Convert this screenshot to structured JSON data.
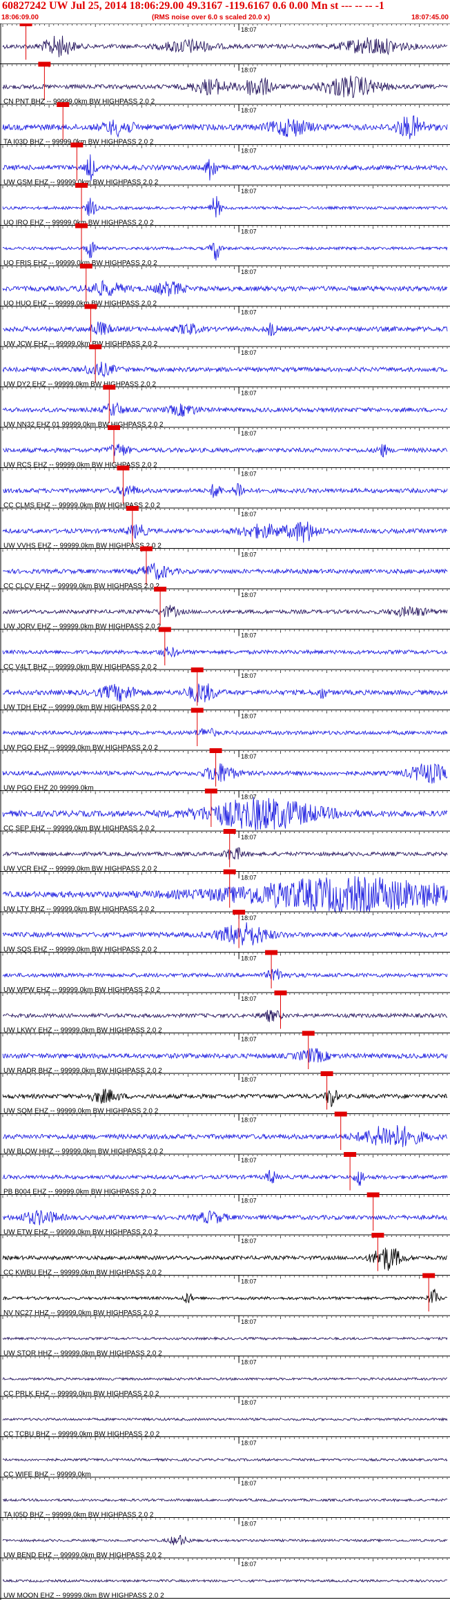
{
  "header": {
    "title": "60827242 UW Jul 25, 2014 18:06:29.00   49.3167 -119.6167  0.6 0.00 Mn st --- -- -- -1",
    "start_time": "18:06:09.00",
    "note": "(RMS noise over 6.0 s scaled 20.0 x)",
    "end_time": "18:07:45.00"
  },
  "chart_data": {
    "type": "line",
    "title": "60827242 UW Jul 25, 2014 18:06:29.00   49.3167 -119.6167  0.6 0.00 Mn st --- -- -- -1",
    "x_start": "18:06:09.00",
    "x_end": "18:07:45.00",
    "x_range_seconds": [
      0,
      96
    ],
    "minute_tick_label": "18:07",
    "minute_tick_second": 51,
    "colors": {
      "blue": "#1f1fe0",
      "navy": "#281860",
      "black": "#000000",
      "pick": "#e00000"
    },
    "traces": [
      {
        "label": "",
        "color": "navy",
        "amp": 0.9,
        "pick": 5,
        "bursts": [
          [
            12,
            3,
            1.0
          ],
          [
            40,
            5,
            0.6
          ],
          [
            80,
            6,
            0.8
          ]
        ]
      },
      {
        "label": "CN PNT BHZ -- 99999.0km BW  HIGHPASS  2.0  2",
        "color": "navy",
        "amp": 0.9,
        "pick": 9,
        "bursts": [
          [
            45,
            4,
            0.7
          ],
          [
            55,
            3,
            1.0
          ],
          [
            75,
            6,
            1.0
          ]
        ]
      },
      {
        "label": "TA I03D BHZ -- 99999.0km BW  HIGHPASS  2.0  2",
        "color": "blue",
        "amp": 1.2,
        "pick": 13,
        "bursts": [
          [
            25,
            3,
            0.7
          ],
          [
            62,
            4,
            0.8
          ],
          [
            88,
            3,
            1.0
          ]
        ]
      },
      {
        "label": "UW GSM EHZ -- 99999.0km BW  HIGHPASS  2.0  2",
        "color": "blue",
        "amp": 1.0,
        "pick": 16,
        "bursts": [
          [
            19,
            1,
            1.2
          ],
          [
            45,
            1,
            1.4
          ]
        ]
      },
      {
        "label": "UO IRO EHZ -- 99999.0km BW  HIGHPASS  2.0  2",
        "color": "blue",
        "amp": 0.6,
        "pick": 17,
        "bursts": [
          [
            19,
            1,
            1.0
          ],
          [
            46,
            1,
            1.2
          ]
        ]
      },
      {
        "label": "UO FRIS EHZ -- 99999.0km BW  HIGHPASS  2.0  2",
        "color": "blue",
        "amp": 0.6,
        "pick": 17,
        "bursts": [
          [
            19,
            1,
            1.0
          ],
          [
            46,
            1,
            1.2
          ]
        ]
      },
      {
        "label": "UO HUO EHZ -- 99999.0km BW  HIGHPASS  2.0  2",
        "color": "blue",
        "amp": 1.0,
        "pick": 18,
        "bursts": [
          [
            22,
            4,
            0.6
          ],
          [
            36,
            3,
            0.6
          ]
        ]
      },
      {
        "label": "UW JCW EHZ -- 99999.0km BW  HIGHPASS  2.0  2",
        "color": "blue",
        "amp": 1.0,
        "pick": 19,
        "bursts": [
          [
            21,
            2,
            0.6
          ],
          [
            40,
            2,
            0.5
          ],
          [
            58,
            1,
            0.6
          ]
        ]
      },
      {
        "label": "UW DY2 EHZ -- 99999.0km BW  HIGHPASS  2.0  2",
        "color": "blue",
        "amp": 0.9,
        "pick": 20,
        "bursts": [
          [
            21,
            3,
            0.6
          ]
        ]
      },
      {
        "label": "UW NN32 EHZ 01 99999.0km BW  HIGHPASS  2.0  2",
        "color": "blue",
        "amp": 0.9,
        "pick": 23,
        "bursts": [
          [
            24,
            2,
            0.6
          ],
          [
            39,
            3,
            0.5
          ]
        ]
      },
      {
        "label": "UW RCS EHZ -- 99999.0km BW  HIGHPASS  2.0  2",
        "color": "blue",
        "amp": 0.9,
        "pick": 24,
        "bursts": [
          [
            25,
            2,
            0.6
          ],
          [
            82,
            1,
            0.6
          ]
        ]
      },
      {
        "label": "CC CLMS EHZ -- 99999.0km BW  HIGHPASS  2.0  2",
        "color": "blue",
        "amp": 0.9,
        "pick": 26,
        "bursts": [
          [
            27,
            2,
            0.5
          ],
          [
            46,
            1,
            0.8
          ],
          [
            51,
            1,
            0.9
          ]
        ]
      },
      {
        "label": "UW VVHS EHZ -- 99999.0km BW  HIGHPASS  2.0  2",
        "color": "blue",
        "amp": 0.9,
        "pick": 28,
        "bursts": [
          [
            29,
            2,
            0.6
          ],
          [
            56,
            5,
            0.6
          ],
          [
            65,
            3,
            1.0
          ]
        ]
      },
      {
        "label": "CC CLCV EHZ -- 99999.0km BW  HIGHPASS  2.0  2",
        "color": "blue",
        "amp": 0.9,
        "pick": 31,
        "bursts": [
          [
            33,
            3,
            0.7
          ]
        ]
      },
      {
        "label": "UW JORV EHZ -- 99999.0km BW  HIGHPASS  2.0  2",
        "color": "navy",
        "amp": 0.8,
        "pick": 34,
        "bursts": [
          [
            36,
            2,
            0.5
          ],
          [
            88,
            4,
            0.4
          ]
        ]
      },
      {
        "label": "CC V4LT BHZ -- 99999.0km BW  HIGHPASS  2.0  2",
        "color": "blue",
        "amp": 0.8,
        "pick": 35,
        "bursts": [
          [
            36,
            2,
            0.4
          ]
        ]
      },
      {
        "label": "UW TDH EHZ -- 99999.0km BW  HIGHPASS  2.0  2",
        "color": "blue",
        "amp": 1.0,
        "pick": 42,
        "bursts": [
          [
            25,
            4,
            0.7
          ],
          [
            43,
            3,
            0.9
          ],
          [
            69,
            1,
            0.5
          ]
        ]
      },
      {
        "label": "UW PGO EHZ -- 99999.0km BW  HIGHPASS  2.0  2",
        "color": "blue",
        "amp": 0.8,
        "pick": 42,
        "bursts": [
          [
            44,
            2,
            0.4
          ]
        ]
      },
      {
        "label": "UW PGO EHZ 20 99999.0km",
        "color": "blue",
        "amp": 0.9,
        "pick": 46,
        "bursts": [
          [
            47,
            3,
            0.9
          ],
          [
            92,
            4,
            0.9
          ]
        ]
      },
      {
        "label": "CC SEP EHZ -- 99999.0km BW  HIGHPASS  2.0  2",
        "color": "blue",
        "amp": 1.2,
        "pick": 45,
        "bursts": [
          [
            56,
            12,
            1.5
          ]
        ]
      },
      {
        "label": "UW VCR EHZ -- 99999.0km BW  HIGHPASS  2.0  2",
        "color": "navy",
        "amp": 0.8,
        "pick": 49,
        "bursts": [
          [
            50,
            2,
            0.6
          ]
        ]
      },
      {
        "label": "UW LTY BHZ -- 99999.0km BW  HIGHPASS  2.0  2",
        "color": "blue",
        "amp": 1.2,
        "pick": 49,
        "bursts": [
          [
            75,
            25,
            1.6
          ]
        ]
      },
      {
        "label": "UW SQS EHZ -- 99999.0km BW  HIGHPASS  2.0  2",
        "color": "blue",
        "amp": 1.0,
        "pick": 51,
        "bursts": [
          [
            52,
            5,
            1.1
          ]
        ]
      },
      {
        "label": "UW WPW EHZ -- 99999.0km BW  HIGHPASS  2.0  2",
        "color": "blue",
        "amp": 0.8,
        "pick": 58,
        "bursts": [
          [
            59,
            2,
            0.5
          ]
        ]
      },
      {
        "label": "UW LKWY EHZ -- 99999.0km BW  HIGHPASS  2.0  2",
        "color": "navy",
        "amp": 0.8,
        "pick": 60,
        "bursts": [
          [
            58,
            2,
            0.5
          ]
        ]
      },
      {
        "label": "UW RADR BHZ -- 99999.0km BW  HIGHPASS  2.0  2",
        "color": "blue",
        "amp": 1.0,
        "pick": 66,
        "bursts": [
          [
            67,
            3,
            0.6
          ]
        ]
      },
      {
        "label": "UW SQM EHZ -- 99999.0km BW  HIGHPASS  2.0  2",
        "color": "black",
        "amp": 0.9,
        "pick": 70,
        "bursts": [
          [
            71,
            1,
            1.2
          ],
          [
            22,
            3,
            0.6
          ]
        ]
      },
      {
        "label": "UW BLOW HHZ -- 99999.0km BW  HIGHPASS  2.0  2",
        "color": "blue",
        "amp": 1.0,
        "pick": 73,
        "bursts": [
          [
            84,
            6,
            1.1
          ]
        ]
      },
      {
        "label": "PB B004 EHZ -- 99999.0km BW  HIGHPASS  2.0  2",
        "color": "blue",
        "amp": 0.8,
        "pick": 75,
        "bursts": [
          [
            58,
            1,
            0.7
          ],
          [
            77,
            1,
            0.8
          ]
        ]
      },
      {
        "label": "UW ETW EHZ -- 99999.0km BW  HIGHPASS  2.0  2",
        "color": "blue",
        "amp": 0.9,
        "pick": 80,
        "bursts": [
          [
            8,
            4,
            0.6
          ],
          [
            45,
            3,
            0.5
          ]
        ]
      },
      {
        "label": "CC KWBU EHZ -- 99999.0km BW  HIGHPASS  2.0  2",
        "color": "black",
        "amp": 0.8,
        "pick": 81,
        "bursts": [
          [
            83,
            3,
            1.2
          ]
        ]
      },
      {
        "label": "NV NC27 HHZ -- 99999.0km BW  HIGHPASS  2.0  2",
        "color": "black",
        "amp": 0.6,
        "pick": 92,
        "bursts": [
          [
            93,
            1,
            0.9
          ],
          [
            40,
            1,
            0.5
          ]
        ]
      },
      {
        "label": "UW STOR HHZ -- 99999.0km BW  HIGHPASS  2.0  2",
        "color": "navy",
        "amp": 0.5,
        "pick": null,
        "bursts": []
      },
      {
        "label": "CC PRLK EHZ -- 99999.0km BW  HIGHPASS  2.0  2",
        "color": "navy",
        "amp": 0.5,
        "pick": null,
        "bursts": []
      },
      {
        "label": "CC TCBU BHZ -- 99999.0km BW  HIGHPASS  2.0  2",
        "color": "navy",
        "amp": 0.5,
        "pick": null,
        "bursts": []
      },
      {
        "label": "CC WIFE BHZ -- 99999.0km",
        "color": "navy",
        "amp": 0.5,
        "pick": null,
        "bursts": []
      },
      {
        "label": "TA I05D BHZ -- 99999.0km BW  HIGHPASS  2.0  2",
        "color": "navy",
        "amp": 0.5,
        "pick": null,
        "bursts": []
      },
      {
        "label": "UW BEND EHZ -- 99999.0km BW  HIGHPASS  2.0  2",
        "color": "navy",
        "amp": 0.5,
        "pick": null,
        "bursts": [
          [
            38,
            2,
            0.5
          ]
        ]
      },
      {
        "label": "UW MOON EHZ -- 99999.0km BW  HIGHPASS  2.0  2",
        "color": "navy",
        "amp": 0.5,
        "pick": null,
        "bursts": []
      }
    ]
  }
}
